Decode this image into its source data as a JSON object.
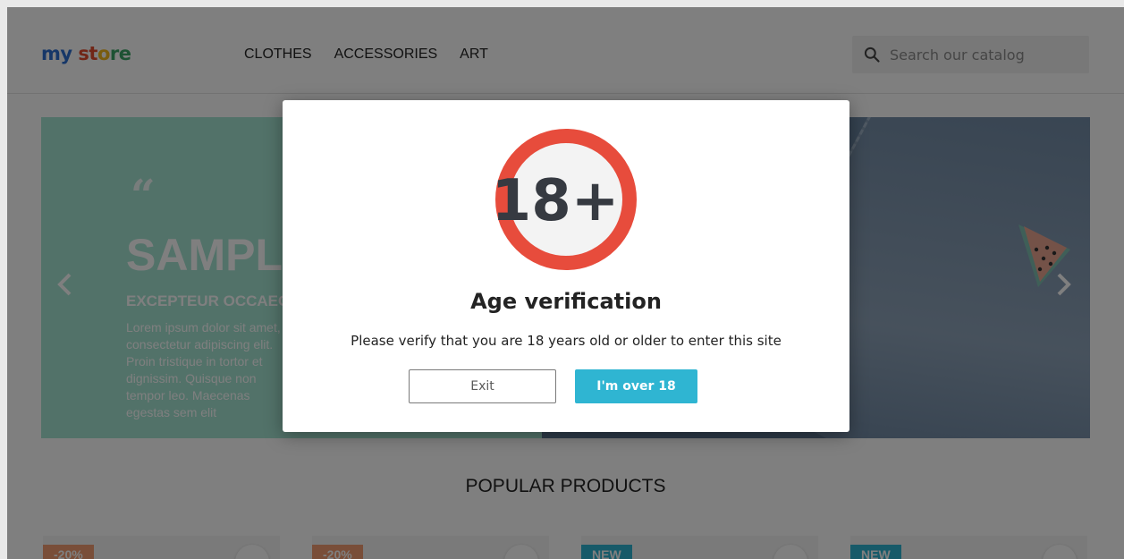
{
  "header": {
    "logo": {
      "part1": "my",
      "part2": "st",
      "part3": "o",
      "part4": "re"
    },
    "nav": [
      "CLOTHES",
      "ACCESSORIES",
      "ART"
    ],
    "search_placeholder": "Search our catalog"
  },
  "carousel": {
    "quote_mark": "“",
    "title": "SAMPLE 1",
    "subtitle": "EXCEPTEUR OCCAECAT",
    "text": "Lorem ipsum dolor sit amet, consectetur adipiscing elit. Proin tristique in tortor et dignissim. Quisque non tempor leo. Maecenas egestas sem elit"
  },
  "popular": {
    "title": "POPULAR PRODUCTS"
  },
  "products": [
    {
      "badge": "-20%",
      "badge_type": "sale"
    },
    {
      "badge": "-20%",
      "badge_type": "sale"
    },
    {
      "badge": "NEW",
      "badge_type": "new"
    },
    {
      "badge": "NEW",
      "badge_type": "new"
    }
  ],
  "modal": {
    "badge_text": "18+",
    "title": "Age verification",
    "message": "Please verify that you are 18 years old or older to enter this site",
    "exit_label": "Exit",
    "confirm_label": "I'm over 18"
  },
  "colors": {
    "accent": "#2fb5d2",
    "badge_ring": "#e74c3c",
    "badge_text": "#363a41",
    "slide_bg": "#a5e4d3",
    "sale": "#f39d72"
  }
}
